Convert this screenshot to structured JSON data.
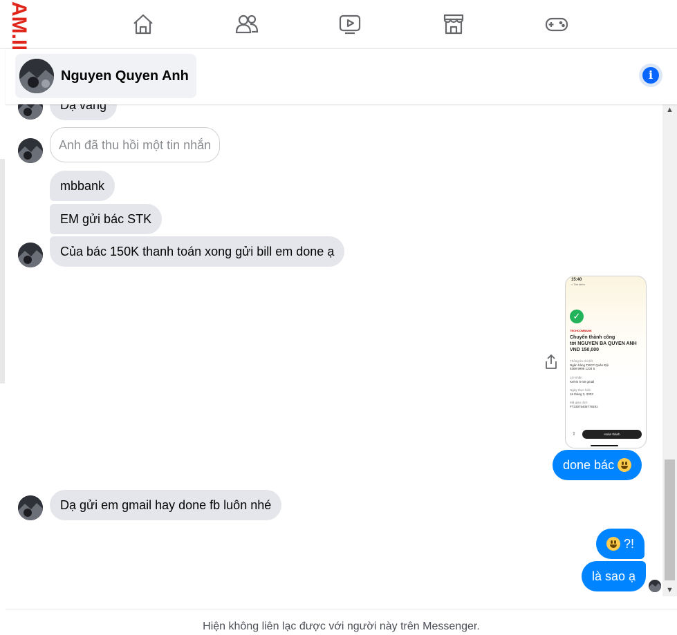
{
  "watermark": {
    "text": "AM.INFO",
    "color": "#e0251b"
  },
  "nav": {
    "icons": [
      "home-icon",
      "friends-icon",
      "watch-video-icon",
      "marketplace-icon",
      "gaming-icon"
    ]
  },
  "header": {
    "contact_name": "Nguyen Quyen Anh",
    "info_icon": "i"
  },
  "messages": {
    "m1": "Dạ vâng",
    "m2_recalled": "Anh đã thu hồi một tin nhắn",
    "m3": "mbbank",
    "m4": "EM gửi bác STK",
    "m5": "Của bác 150K thanh toán xong gửi bill em done ạ",
    "m6_out": "done bác",
    "m7": "Dạ gửi em gmail hay done fb luôn nhé",
    "m8_out": "?!",
    "m9_out": "là sao ạ"
  },
  "receipt": {
    "time": "15:40",
    "tiny": "< Tìm kiếm",
    "bank": "TECHCOMBANK",
    "title_line1": "Chuyển thành công",
    "title_line2": "tới NGUYEN BA QUYEN ANH",
    "amount": "VND 150,000",
    "detail_label": "Thông tin chi tiết",
    "detail_bank": "Ngân hàng TMCP Quân Đội",
    "detail_account": "5368 9999 1234 5",
    "note_label": "Lời nhắn",
    "note_value": "Kelvin le 50 gmail",
    "date_label": "Ngày thực hiện",
    "date_value": "16 tháng 3, 2023",
    "txn_label": "Mã giao dịch",
    "txn_value": "FT23075406778191",
    "done_button": "Hoàn thành"
  },
  "footer": {
    "status_text": "Hiện không liên lạc được với người này trên Messenger."
  },
  "colors": {
    "outgoing_bubble": "#0084ff",
    "incoming_bubble": "#e4e6eb",
    "accent": "#0866ff"
  }
}
